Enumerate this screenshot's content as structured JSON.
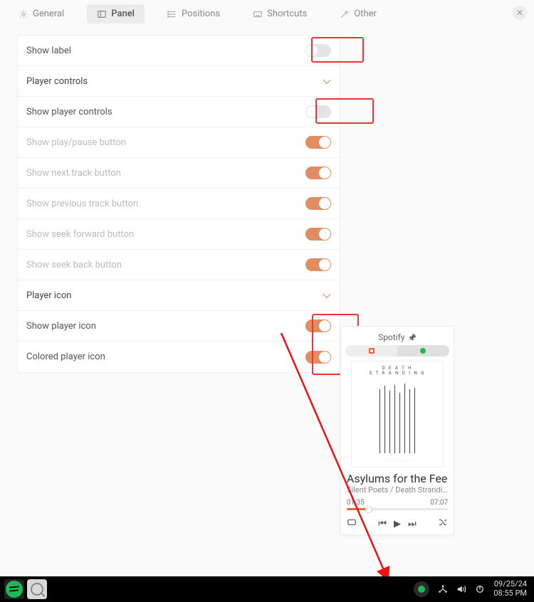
{
  "tabs": {
    "general": "General",
    "panel": "Panel",
    "positions": "Positions",
    "shortcuts": "Shortcuts",
    "other": "Other"
  },
  "settings": {
    "show_label": "Show label",
    "player_controls_header": "Player controls",
    "show_player_controls": "Show player controls",
    "show_play_pause": "Show play/pause button",
    "show_next": "Show next track button",
    "show_prev": "Show previous track button",
    "show_seek_fwd": "Show seek forward button",
    "show_seek_back": "Show seek back button",
    "player_icon_header": "Player icon",
    "show_player_icon": "Show player icon",
    "colored_player_icon": "Colored player icon"
  },
  "media": {
    "app": "Spotify",
    "album_top": "D E A T H",
    "album_top2": "S T R A N D I N G",
    "track_title": "Asylums for the Feeli",
    "track_sub": "Silent Poets / Death Stranding",
    "time_cur": "01:35",
    "time_total": "07:07"
  },
  "taskbar": {
    "date": "09/25/24",
    "time": "08:55 PM"
  }
}
